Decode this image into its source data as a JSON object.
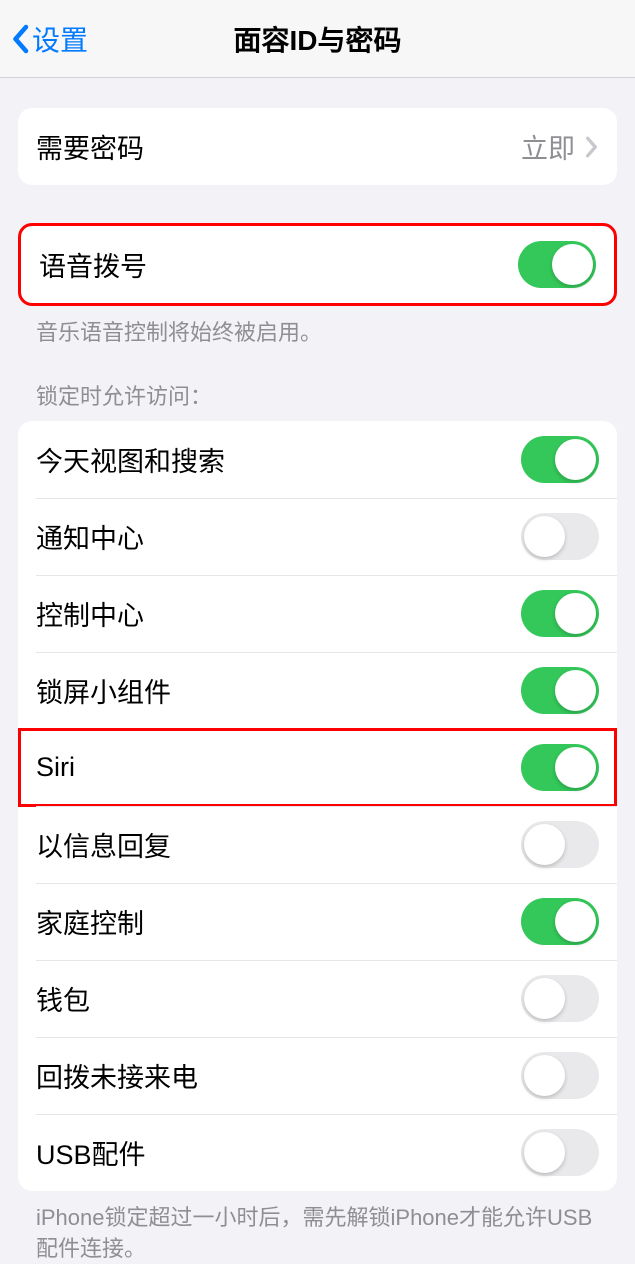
{
  "nav": {
    "back_label": "设置",
    "title": "面容ID与密码"
  },
  "passcode": {
    "require_label": "需要密码",
    "require_value": "立即"
  },
  "voice": {
    "label": "语音拨号",
    "footer": "音乐语音控制将始终被启用。"
  },
  "locked_access": {
    "header": "锁定时允许访问：",
    "items": [
      {
        "label": "今天视图和搜索",
        "on": true
      },
      {
        "label": "通知中心",
        "on": false
      },
      {
        "label": "控制中心",
        "on": true
      },
      {
        "label": "锁屏小组件",
        "on": true
      },
      {
        "label": "Siri",
        "on": true
      },
      {
        "label": "以信息回复",
        "on": false
      },
      {
        "label": "家庭控制",
        "on": true
      },
      {
        "label": "钱包",
        "on": false
      },
      {
        "label": "回拨未接来电",
        "on": false
      },
      {
        "label": "USB配件",
        "on": false
      }
    ],
    "footer": "iPhone锁定超过一小时后，需先解锁iPhone才能允许USB配件连接。"
  },
  "highlights": {
    "voice_row": true,
    "siri_row_index": 4
  }
}
